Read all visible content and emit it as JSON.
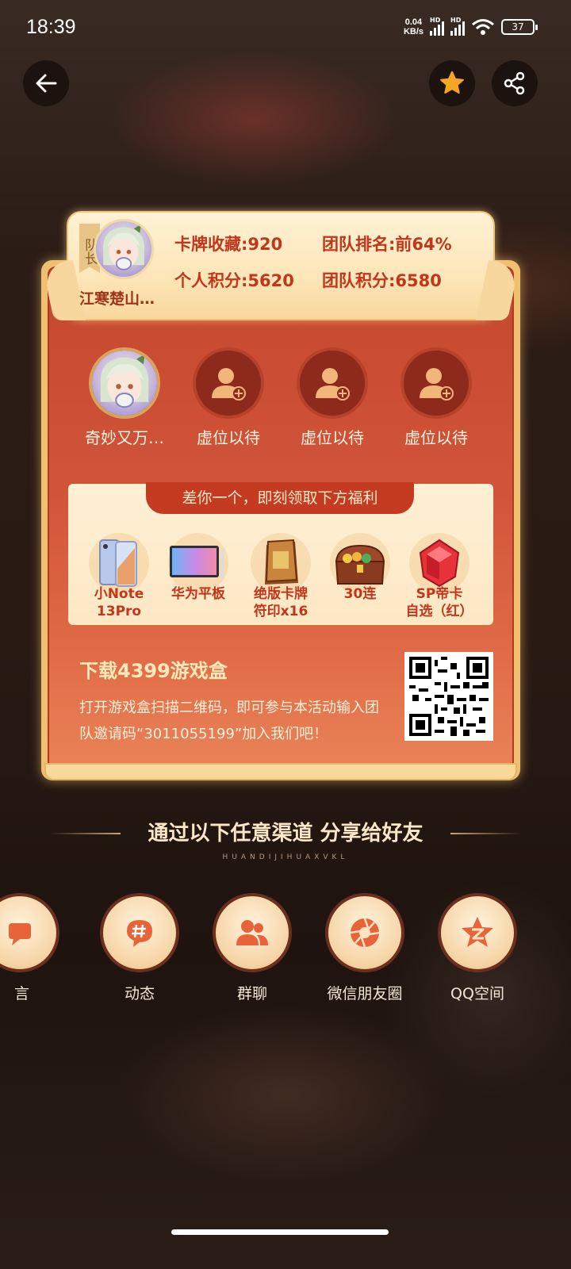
{
  "status_bar": {
    "time": "18:39",
    "net_speed_value": "0.04",
    "net_speed_unit": "KB/s",
    "signal_label": "HD",
    "battery": "37"
  },
  "header": {
    "captain_tag": "队长",
    "leader_name": "江寒楚山…",
    "stats": {
      "card_collection": "卡牌收藏:920",
      "team_rank": "团队排名:前64%",
      "personal_points": "个人积分:5620",
      "team_points": "团队积分:6580"
    }
  },
  "members": [
    {
      "name": "奇妙又万…",
      "filled": true
    },
    {
      "name": "虚位以待",
      "filled": false
    },
    {
      "name": "虚位以待",
      "filled": false
    },
    {
      "name": "虚位以待",
      "filled": false
    }
  ],
  "rewards": {
    "ribbon": "差你一个，即刻领取下方福利",
    "items": [
      {
        "line1": "小Note",
        "line2": "13Pro"
      },
      {
        "line1": "华为平板",
        "line2": ""
      },
      {
        "line1": "绝版卡牌",
        "line2": "符印x16"
      },
      {
        "line1": "30连",
        "line2": ""
      },
      {
        "line1": "SP帝卡",
        "line2": "自选（红）"
      }
    ]
  },
  "download": {
    "title": "下载4399游戏盒",
    "text": "打开游戏盒扫描二维码，即可参与本活动输入团队邀请码“3011055199”加入我们吧！"
  },
  "share": {
    "title": "通过以下任意渠道  分享给好友",
    "subtitle": "HUANDIJIHUAXVKL",
    "items": [
      {
        "label": "言",
        "icon": "chat-icon"
      },
      {
        "label": "动态",
        "icon": "hashtag-icon"
      },
      {
        "label": "群聊",
        "icon": "group-icon"
      },
      {
        "label": "微信朋友圈",
        "icon": "aperture-icon"
      },
      {
        "label": "QQ空间",
        "icon": "star-icon"
      }
    ]
  },
  "colors": {
    "card_red": "#d1553a",
    "accent_text": "#c2361c",
    "plate_cream": "#fde6b8",
    "gold_star": "#f6a623"
  }
}
